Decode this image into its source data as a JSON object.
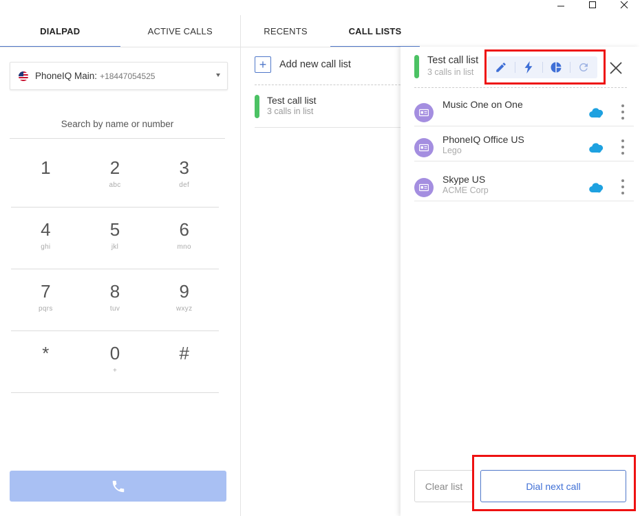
{
  "window": {
    "controls": [
      "minimize",
      "maximize",
      "close"
    ]
  },
  "left_panel": {
    "tabs": [
      {
        "label": "DIALPAD",
        "active": true
      },
      {
        "label": "ACTIVE CALLS",
        "active": false
      }
    ],
    "line": {
      "name": "PhoneIQ Main:",
      "number": "+18447054525",
      "flag_icon": "us-flag-icon"
    },
    "search_placeholder": "Search by name or number",
    "keypad": [
      [
        {
          "digit": "1",
          "letters": ""
        },
        {
          "digit": "2",
          "letters": "abc"
        },
        {
          "digit": "3",
          "letters": "def"
        }
      ],
      [
        {
          "digit": "4",
          "letters": "ghi"
        },
        {
          "digit": "5",
          "letters": "jkl"
        },
        {
          "digit": "6",
          "letters": "mno"
        }
      ],
      [
        {
          "digit": "7",
          "letters": "pqrs"
        },
        {
          "digit": "8",
          "letters": "tuv"
        },
        {
          "digit": "9",
          "letters": "wxyz"
        }
      ],
      [
        {
          "digit": "*",
          "letters": ""
        },
        {
          "digit": "0",
          "letters": "+"
        },
        {
          "digit": "#",
          "letters": ""
        }
      ]
    ],
    "call_button_icon": "phone-icon"
  },
  "main_panel": {
    "tabs": [
      {
        "label": "RECENTS",
        "active": false
      },
      {
        "label": "CALL LISTS",
        "active": true
      }
    ],
    "add_label": "Add new call list",
    "call_lists": [
      {
        "title": "Test call list",
        "sub": "3 calls in list",
        "color": "#4cc264"
      }
    ]
  },
  "drawer": {
    "title": "Test call list",
    "sub": "3 calls in list",
    "toolbar_icons": [
      "pencil-icon",
      "lightning-icon",
      "pie-chart-icon",
      "refresh-icon"
    ],
    "contacts": [
      {
        "name": "Music One on One",
        "company": ""
      },
      {
        "name": "PhoneIQ Office US",
        "company": "Lego"
      },
      {
        "name": "Skype US",
        "company": "ACME Corp"
      }
    ],
    "clear_label": "Clear list",
    "dial_label": "Dial next call"
  },
  "colors": {
    "accent": "#4f77c9",
    "list_green": "#4cc264",
    "avatar": "#a48ee0",
    "highlight": "#ee1111",
    "salesforce": "#1ea1e0"
  }
}
